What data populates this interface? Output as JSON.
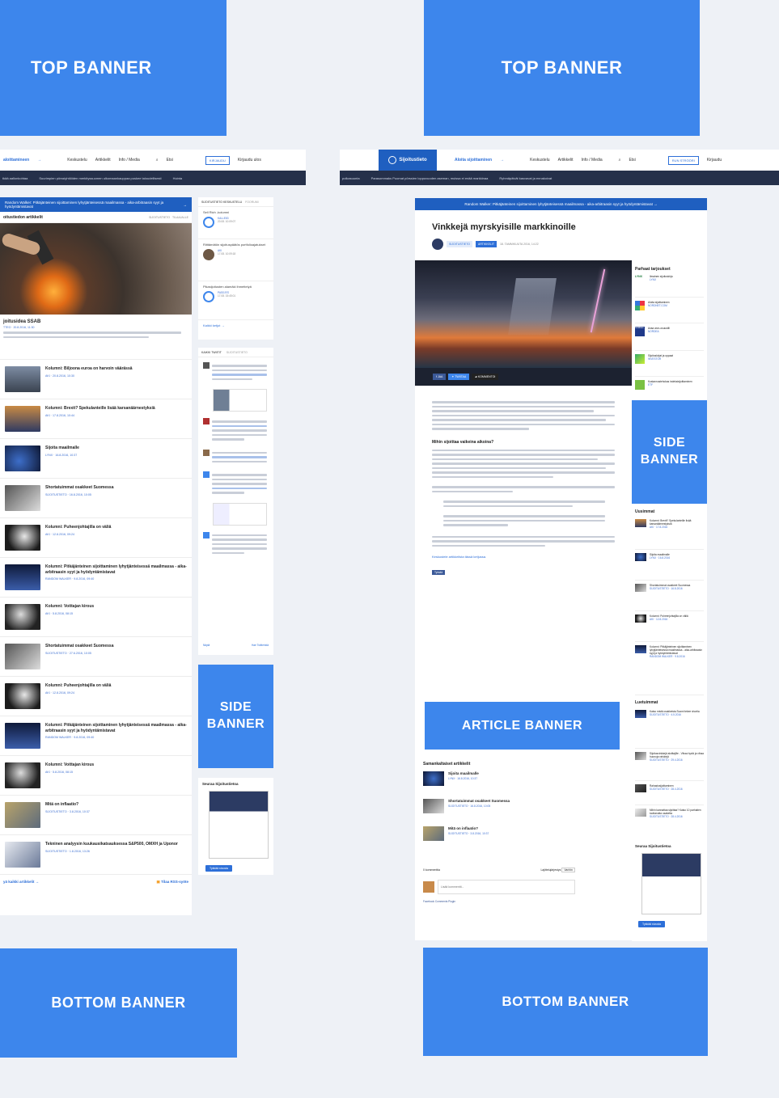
{
  "banners": {
    "top_left": "TOP BANNER",
    "top_right": "TOP BANNER",
    "side_left": "SIDE BANNER",
    "side_right": "SIDE BANNER",
    "article": "ARTICLE BANNER",
    "bottom_left": "BOTTOM BANNER",
    "bottom_right": "BOTTOM BANNER"
  },
  "left": {
    "nav": {
      "cta": "aloittamineen",
      "items": [
        "Keskustelu",
        "Artikkelit",
        "Info / Media"
      ],
      "search": "Etsi",
      "subscribe": "KIRJAUDU",
      "login": "Kirjaudu ulos"
    },
    "ticker": [
      "tkää aallonkohtaa",
      "Suurimpien pörssiyhtiöiden merkityssuomen ulkomaankauppaa puskee taloudellisesti",
      "Huinta"
    ],
    "strip": "Random Walker: Pitkäjänteinen sijoittaminen lyhytjänteisessä maailmassa - aika-arbitraasin syyt ja hyödyntämistavat",
    "section": "oitustiedon artikkelit",
    "section_tabs": [
      "SIJOITUSTIETO",
      "TILAAJALLE"
    ],
    "feature_title": "joitusidea SSAB",
    "feature_meta": "TTEO · 20.8.2016, 11:30",
    "articles": [
      {
        "title": "Kolumni: Biljoona euroa on harvoin väärässä",
        "meta": "AKI · 20.8.2016, 10:30"
      },
      {
        "title": "Kolumni: Brexit? Spekulanteille lisää karsanäärnestyksiä",
        "meta": "AKI · 17.8.2016, 10:44"
      },
      {
        "title": "Sijoita maailmalle",
        "meta": "LYNX · 16.8.2016, 10:37"
      },
      {
        "title": "Shortatuimmat osakkeet Suomessa",
        "meta": "SIJOITUSTIETO · 16.8.2016, 10:05"
      },
      {
        "title": "Kolumni: Puheenjohtajilla on väliä",
        "meta": "AKI · 12.8.2016, 09:24"
      },
      {
        "title": "Kolumni: Pitkäjänteinen sijoittaminen lyhytjänteisessä maailmassa - aika-arbitraasin syyt ja hyödyntämistavat",
        "meta": "RANDOM WALKER · 9.8.2016, 09:40"
      },
      {
        "title": "Kolumni: Voittajan kirous",
        "meta": "AKI · 5.8.2016, 08:15"
      },
      {
        "title": "Shortatuimmat osakkeet Suomessa",
        "meta": "SIJOITUSTIETO · 27.6.2016, 10:05"
      },
      {
        "title": "Kolumni: Puheenjohtajilla on väliä",
        "meta": "AKI · 12.8.2016, 09:24"
      },
      {
        "title": "Kolumni: Pitkäjänteinen sijoittaminen lyhytjänteisessä maailmassa - aika-arbitraasin syyt ja hyödyntämistavat",
        "meta": "RANDOM WALKER · 9.8.2016, 09:40"
      },
      {
        "title": "Kolumni: Voittajan kirous",
        "meta": "AKI · 5.8.2016, 08:15"
      },
      {
        "title": "Mitä on inflaatio?",
        "meta": "SIJOITUSTIETO · 3.8.2016, 10:37"
      },
      {
        "title": "Tekninen analyysin kuukausikatsauksessa S&P500, OMXH ja Uponor",
        "meta": "SIJOITUSTIETO · 1.8.2016, 13:26"
      }
    ],
    "footer_all": "yä kaikki artikkelit",
    "footer_rss": "Tilaa RSS-syöte",
    "discussion_tabs": [
      "SIJOITUSTIETO KESKUSTELU",
      "FOORUMI"
    ],
    "discussions": [
      {
        "title": "Sell Rich -kolumni",
        "author": "KALLE83",
        "time": "20.08. 10:09:07"
      },
      {
        "title": "Riittämätön sijoituspäätös portfolioajatukset",
        "author": "AKI",
        "time": "17.08. 10:09:18"
      },
      {
        "title": "Pikasijoitusten alamäki ihmettelyä",
        "author": "PASI1970",
        "time": "17.08. 15:45:01"
      }
    ],
    "all_discussions": "Kaikki ketjut",
    "twitter_tabs": [
      "KAIKKI TWIITIT",
      "SIJOITUSTIETO"
    ],
    "twitter_footer": [
      "Näytä",
      "Hae Twitteristä"
    ],
    "follow_title": "Seuraa Sijoitustietoa",
    "fb_like": "Tykkää sivusta"
  },
  "right": {
    "logo": "Sijoitustieto",
    "nav": {
      "cta": "Aloita sijoittaminen",
      "items": [
        "Keskustelu",
        "Artikkelit",
        "Info / Media"
      ],
      "search": "Etsi",
      "subscribe": "RUN STRÖÖRI",
      "login": "Kirjaudu"
    },
    "ticker": [
      "polkasuunta",
      "Parasommaks Puomat pörssien loppuvuoden aseman, muissa ei enää markkinaa",
      "Ryhmäpäivät kasvavat ja ennakoivat"
    ],
    "strip": "Random Walker: Pitkäjänteinen sijoittaminen lyhytjänteisessä maailmassa - aika-arbitraasin syyt ja hyödyntämistavat",
    "article": {
      "title": "Vinkkejä myrskyisille markkinoille",
      "tags": [
        "SIJOITUSTIETO",
        "ARTIKKELIT"
      ],
      "date": "18. TAMMIKUUTA 2016, 14:22",
      "share": [
        "JAA",
        "TWIITAA",
        "KOMMENTOI"
      ],
      "subheading": "Mihin sijoittaa vaikeina aikoina?",
      "link": "Keskustele artikkelista tässä ketjussa.",
      "like": "Tykkää"
    },
    "related_title": "Samankaltaiset artikkelit",
    "related": [
      {
        "title": "Sijoita maailmalle",
        "meta": "LYNX · 16.8.2016, 10:37"
      },
      {
        "title": "Shortatuimmat osakkeet Suomessa",
        "meta": "SIJOITUSTIETO · 16.8.2016, 10:05"
      },
      {
        "title": "Mitä on inflaatio?",
        "meta": "SIJOITUSTIETO · 3.8.2016, 10:37"
      }
    ],
    "comments": {
      "count": "0 kommenttia",
      "sort_label": "Lajittelujärjestys",
      "sort": "Vanhin",
      "placeholder": "Lisää kommentti...",
      "plugin": "Facebook Comments Plugin"
    },
    "offers_title": "Parhaat tarjoukset",
    "offers": [
      {
        "brand": "LYNX",
        "text": "Ilmainen sijoituskirja",
        "sub": "LYNX"
      },
      {
        "brand": "NORDNET",
        "text": "Aloita sijoittaminen",
        "sub": "NORDNET.COM"
      },
      {
        "brand": "NORDEA",
        "text": "Avaa arvo-osuustili",
        "sub": "NORDEA"
      },
      {
        "brand": "INVESTOR",
        "text": "Sijoituskirjat ja oppaat",
        "sub": "INVESTOR"
      },
      {
        "brand": "ETF",
        "text": "Kustannustehokas indeksisijoittaminen",
        "sub": "ETF"
      }
    ],
    "latest_title": "Uusimmat",
    "latest": [
      {
        "title": "Kolumni: Brexit? Spekulanteille lisää karsanäärnestyksiä",
        "meta": "AKI · 17.8.2016"
      },
      {
        "title": "Sijoita maailmalle",
        "meta": "LYNX · 16.8.2016"
      },
      {
        "title": "Shortatuimmat osakkeet Suomessa",
        "meta": "SIJOITUSTIETO · 16.8.2016"
      },
      {
        "title": "Kolumni: Puheenjohtajilla on väliä",
        "meta": "AKI · 12.8.2016"
      },
      {
        "title": "Kolumni: Pitkäjänteinen sijoittaminen lyhytjänteisessä maailmassa - aika-arbitraasin syyt ja hyödyntämistavat",
        "meta": "RANDOM WALKER · 9.8.2016"
      }
    ],
    "popular_title": "Luetuimmat",
    "popular": [
      {
        "title": "Katso mistä osakkeista Suomi tekee shortia",
        "meta": "SIJOITUSTIETO · 4.5.2016"
      },
      {
        "title": "Sijoitusvinkkejä aloittajille - Vihaa hyviä ja vihaa huonoja vinkkejä",
        "meta": "SIJOITUSTIETO · 29.4.2016"
      },
      {
        "title": "Rahastosijoittaminen",
        "meta": "SIJOITUSTIETO · 28.4.2016"
      },
      {
        "title": "Mihin kannattaa sijoittaa? Katso 10 parhaiten tuottanutta osaketta",
        "meta": "SIJOITUSTIETO · 28.4.2016"
      }
    ],
    "follow_title": "Seuraa Sijoitustietoa",
    "fb_like": "Tykkää sivusta"
  }
}
